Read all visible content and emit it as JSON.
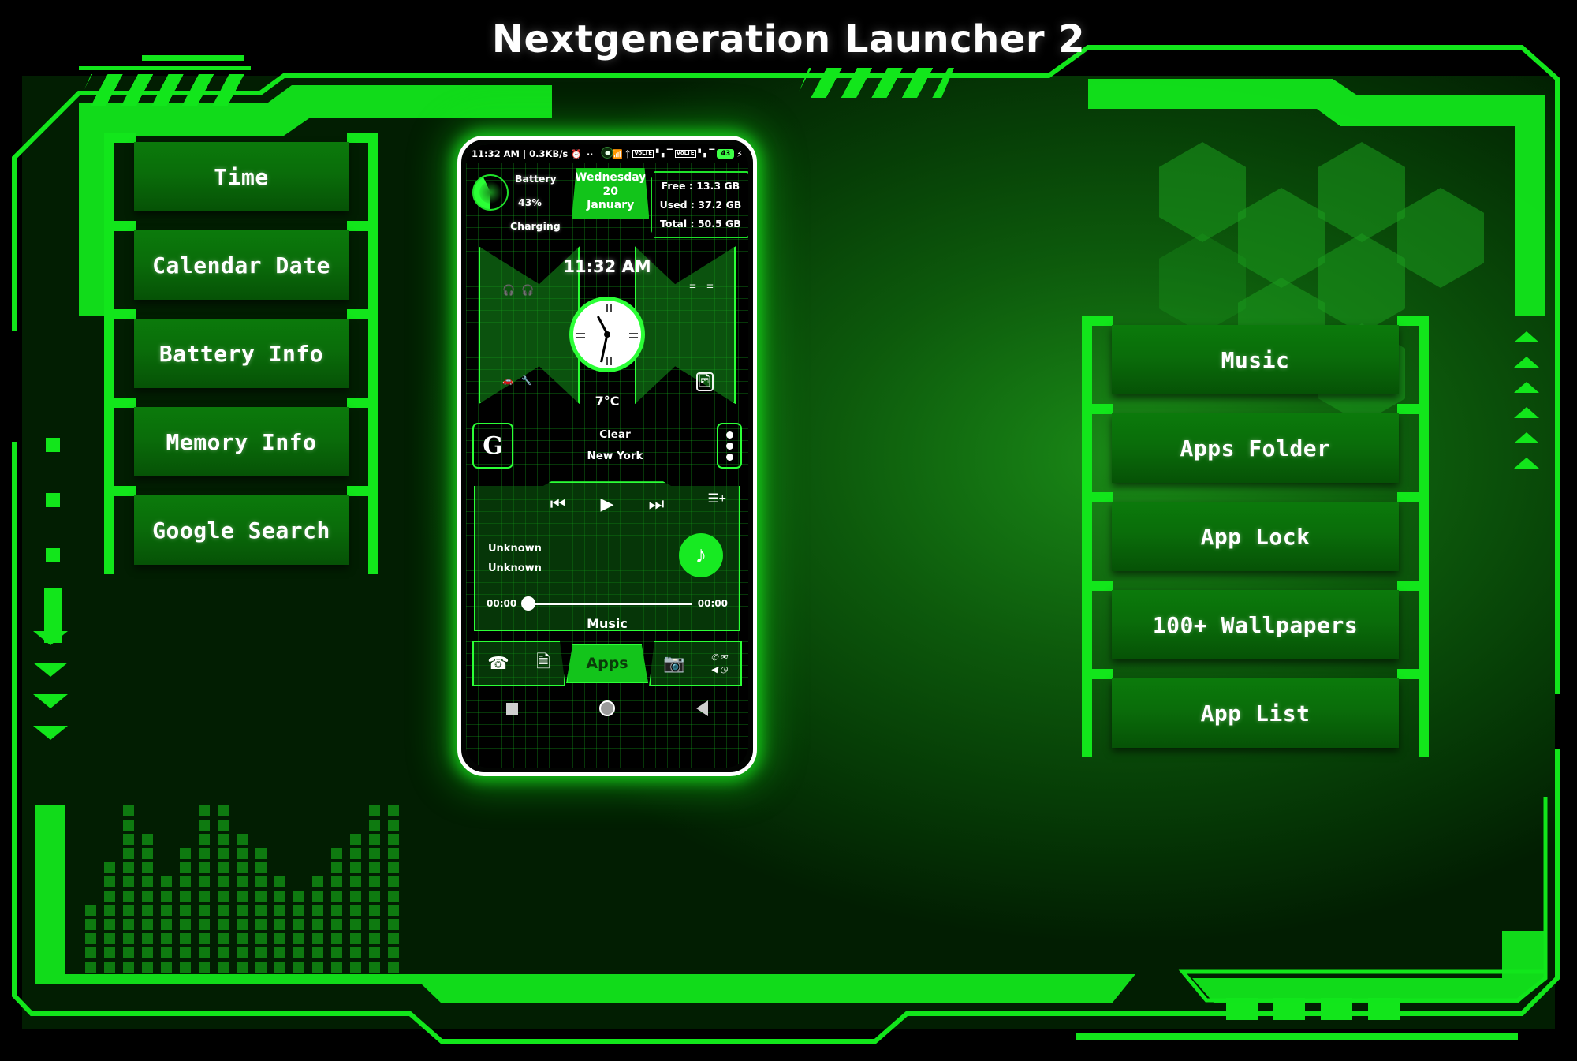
{
  "app": {
    "title": "Nextgeneration Launcher 2",
    "accent": "#12e61b",
    "panel_green": "#0b7a0b",
    "bright_green": "#2bff36"
  },
  "left_menu": {
    "items": [
      {
        "label": "Time"
      },
      {
        "label": "Calendar Date"
      },
      {
        "label": "Battery Info"
      },
      {
        "label": "Memory Info"
      },
      {
        "label": "Google Search"
      }
    ]
  },
  "right_menu": {
    "items": [
      {
        "label": "Music"
      },
      {
        "label": "Apps Folder"
      },
      {
        "label": "App Lock"
      },
      {
        "label": "100+ Wallpapers"
      },
      {
        "label": "App List"
      }
    ]
  },
  "phone": {
    "statusbar": {
      "left_text": "11:32 AM | 0.3KB/s",
      "alarm_icon": "alarm-clock-icon",
      "more_dots": "··",
      "wifi_icon": "wifi-icon",
      "bluetooth_icon": "bluetooth-icon",
      "volte_1": "VoLTE",
      "network_label": "4G+",
      "signal_icon_1": "signal-bars-icon",
      "volte_2": "VoLTE",
      "signal_icon_2": "signal-bars-icon",
      "battery_level": "43",
      "charging_icon": "charging-bolt-icon"
    },
    "battery_widget": {
      "title": "Battery",
      "percent": "43%",
      "state": "Charging"
    },
    "date_widget": {
      "weekday": "Wednesday",
      "day": "20",
      "month": "January"
    },
    "memory_widget": {
      "free": "Free : 13.3 GB",
      "used": "Used : 37.2 GB",
      "total": "Total : 50.5 GB"
    },
    "clock_widget": {
      "digital_time": "11:32 AM",
      "temperature": "7°C",
      "shortcuts": [
        "headphones-icon",
        "headphones-icon",
        "playlist-icon",
        "list-icon",
        "car-icon",
        "tools-icon",
        "gallery-icon"
      ]
    },
    "search_row": {
      "google_label": "G",
      "weather_condition": "Clear",
      "weather_city": "New York",
      "overflow_icon": "three-dots-icon"
    },
    "music_player": {
      "previous_icon": "skip-previous-icon",
      "play_icon": "play-icon",
      "next_icon": "skip-next-icon",
      "playlist_add_icon": "playlist-add-icon",
      "track_title": "Unknown",
      "track_artist": "Unknown",
      "elapsed": "00:00",
      "duration": "00:00",
      "note_icon": "music-note-icon",
      "label": "Music"
    },
    "dock": {
      "phone_icon": "phone-icon",
      "messages_icon": "messages-icon",
      "apps_label": "Apps",
      "camera_icon": "camera-icon",
      "folder_icons": [
        "whatsapp-icon",
        "email-icon",
        "telegram-icon",
        "clock-app-icon"
      ]
    },
    "navbar": {
      "recents_icon": "recents-square-icon",
      "home_icon": "home-circle-icon",
      "back_icon": "back-triangle-icon"
    }
  },
  "equalizer": {
    "bars": [
      5,
      8,
      12,
      10,
      7,
      9,
      12,
      12,
      10,
      9,
      7,
      6,
      7,
      9,
      10,
      12,
      12
    ]
  }
}
